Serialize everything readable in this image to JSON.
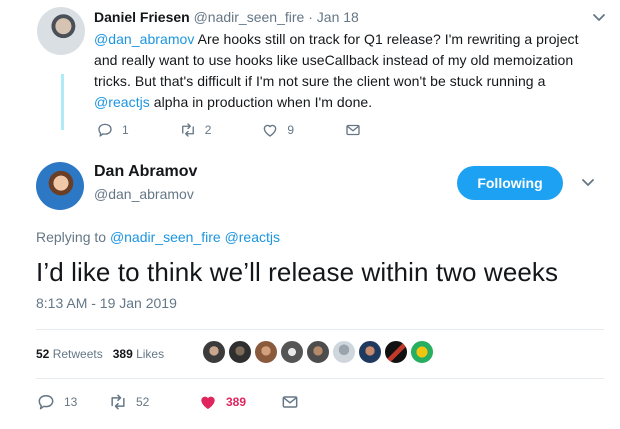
{
  "parent_tweet": {
    "author_name": "Daniel Friesen",
    "author_handle": "@nadir_seen_fire",
    "separator": "·",
    "date": "Jan 18",
    "mention": "@dan_abramov",
    "text_part1": " Are hooks still on track for Q1 release? I'm rewriting a project and really want to use hooks like useCallback instead of my old memoization tricks. But that's difficult if I'm not sure the client won't be stuck running a ",
    "mention2": "@reactjs",
    "text_part2": " alpha in production when I'm done.",
    "reply_count": "1",
    "retweet_count": "2",
    "like_count": "9"
  },
  "main_tweet": {
    "author_name": "Dan Abramov",
    "author_handle": "@dan_abramov",
    "follow_label": "Following",
    "replying_prefix": "Replying to ",
    "replying_to_1": "@nadir_seen_fire",
    "replying_to_2": "@reactjs",
    "text": "I’d like to think we’ll release within two weeks",
    "timestamp": "8:13 AM - 19 Jan 2019",
    "retweets_count": "52",
    "retweets_label": " Retweets",
    "likes_count": "389",
    "likes_label": " Likes",
    "reply_count": "13",
    "retweet_count": "52",
    "like_count": "389"
  },
  "colors": {
    "accent": "#1da1f2",
    "link": "#1b95e0",
    "muted": "#657786",
    "like": "#e0245e",
    "thread_line": "#aeeaf7"
  },
  "icons": [
    "chevron-down-icon",
    "reply-icon",
    "retweet-icon",
    "heart-icon",
    "mail-icon",
    "heart-filled-icon"
  ]
}
